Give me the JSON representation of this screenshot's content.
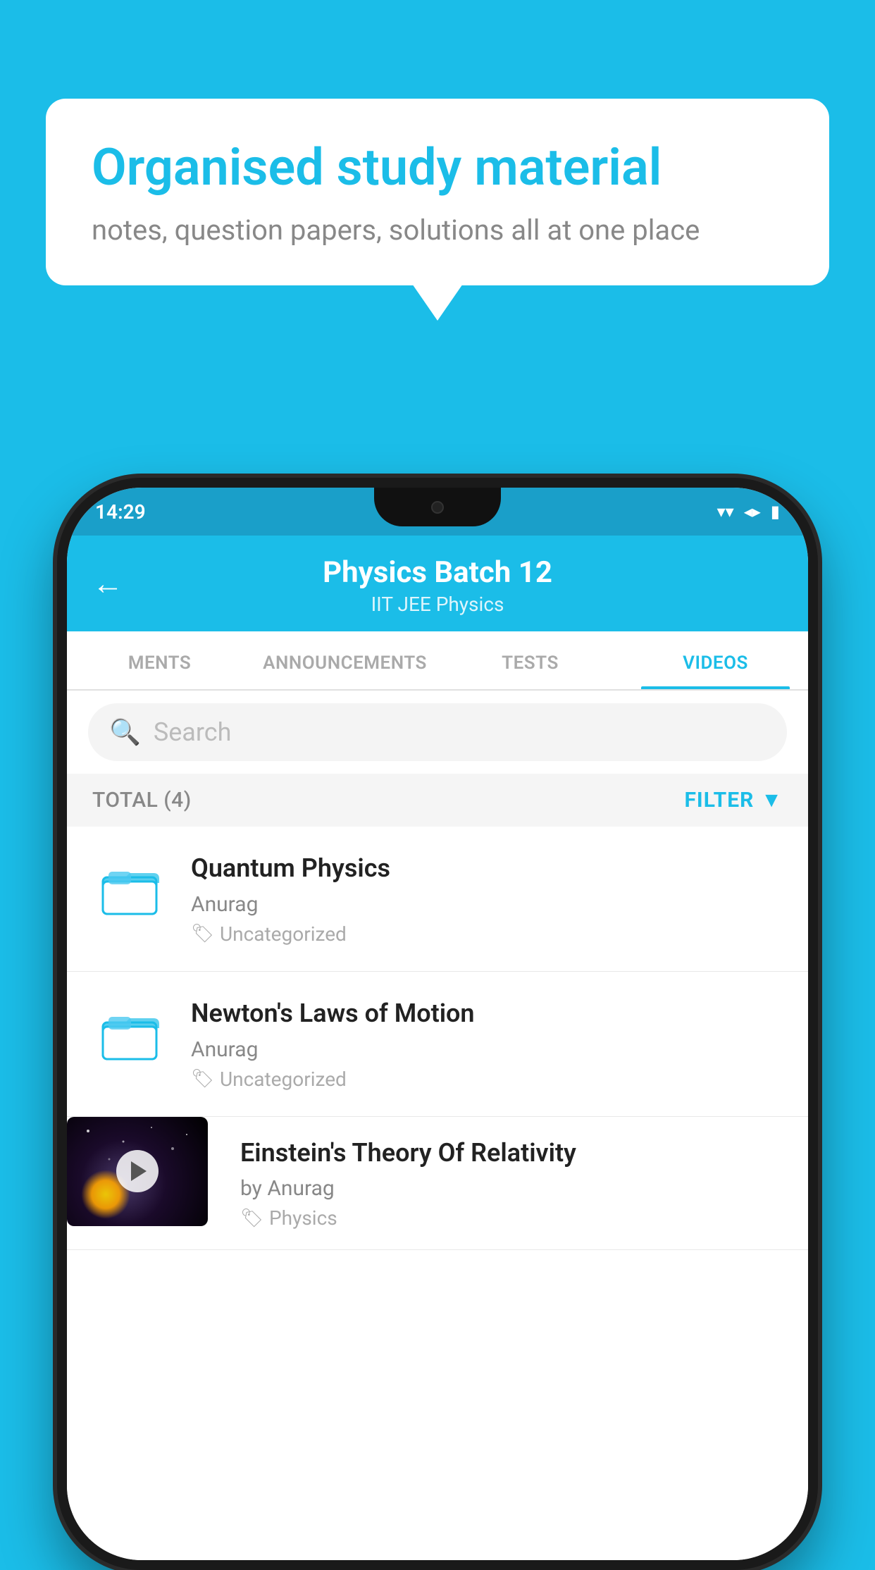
{
  "background_color": "#1BBDE8",
  "speech_bubble": {
    "title": "Organised study material",
    "subtitle": "notes, question papers, solutions all at one place"
  },
  "phone": {
    "status_bar": {
      "time": "14:29",
      "icons": [
        "wifi",
        "signal",
        "battery"
      ]
    },
    "header": {
      "back_label": "←",
      "title": "Physics Batch 12",
      "subtitle": "IIT JEE   Physics"
    },
    "tabs": [
      {
        "label": "MENTS",
        "active": false
      },
      {
        "label": "ANNOUNCEMENTS",
        "active": false
      },
      {
        "label": "TESTS",
        "active": false
      },
      {
        "label": "VIDEOS",
        "active": true
      }
    ],
    "search": {
      "placeholder": "Search"
    },
    "filter_bar": {
      "total_label": "TOTAL (4)",
      "filter_label": "FILTER"
    },
    "videos": [
      {
        "id": 1,
        "title": "Quantum Physics",
        "author": "Anurag",
        "tag": "Uncategorized",
        "type": "folder",
        "has_thumbnail": false
      },
      {
        "id": 2,
        "title": "Newton's Laws of Motion",
        "author": "Anurag",
        "tag": "Uncategorized",
        "type": "folder",
        "has_thumbnail": false
      },
      {
        "id": 3,
        "title": "Einstein's Theory Of Relativity",
        "author": "by Anurag",
        "tag": "Physics",
        "type": "video",
        "has_thumbnail": true
      }
    ]
  }
}
